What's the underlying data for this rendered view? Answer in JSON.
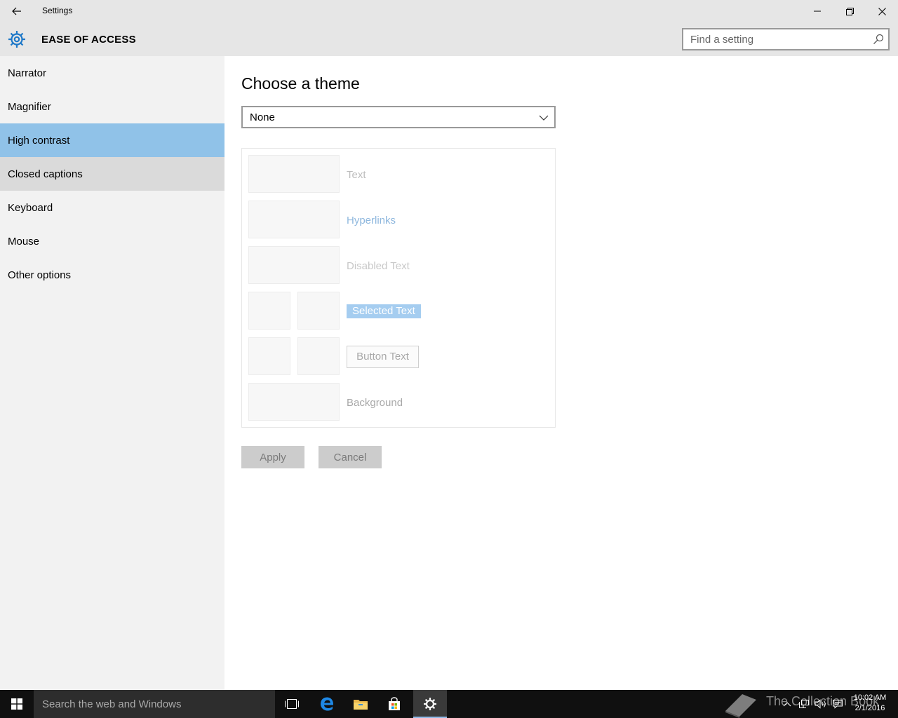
{
  "window": {
    "title": "Settings",
    "controls": {
      "minimize": "minimize-icon",
      "maximize": "restore-icon",
      "close": "close-icon"
    }
  },
  "header": {
    "icon": "gear-icon",
    "title": "EASE OF ACCESS",
    "search_placeholder": "Find a setting"
  },
  "sidebar": {
    "items": [
      {
        "label": "Narrator",
        "state": "normal"
      },
      {
        "label": "Magnifier",
        "state": "normal"
      },
      {
        "label": "High contrast",
        "state": "selected"
      },
      {
        "label": "Closed captions",
        "state": "hover"
      },
      {
        "label": "Keyboard",
        "state": "normal"
      },
      {
        "label": "Mouse",
        "state": "normal"
      },
      {
        "label": "Other options",
        "state": "normal"
      }
    ]
  },
  "main": {
    "heading": "Choose a theme",
    "theme_select": {
      "value": "None"
    },
    "preview": {
      "text": "Text",
      "hyperlinks": "Hyperlinks",
      "disabled_text": "Disabled Text",
      "selected_text": "Selected Text",
      "button_text": "Button Text",
      "background": "Background"
    },
    "apply_label": "Apply",
    "cancel_label": "Cancel"
  },
  "taskbar": {
    "search_text": "Search the web and Windows",
    "icons": [
      "windows-start-icon",
      "task-view-icon",
      "edge-icon",
      "file-explorer-icon",
      "store-icon",
      "settings-gear-icon"
    ],
    "watermark_text": "The Collection Book",
    "time": "10:02 AM",
    "date": "2/1/2016"
  },
  "colors": {
    "selected_nav": "#90c2e8",
    "hover_nav": "#dadada",
    "chrome": "#e6e6e6",
    "hyperlink": "#8fb8de",
    "taskbar": "#101010"
  }
}
